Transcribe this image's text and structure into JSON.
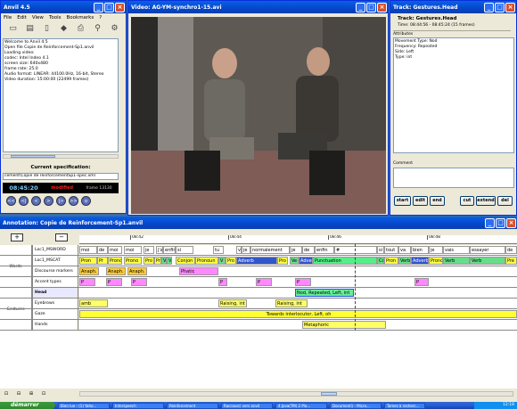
{
  "anvil_window": {
    "title": "Anvil 4.5",
    "menu": [
      "File",
      "Edit",
      "View",
      "Tools",
      "Bookmarks",
      "?"
    ],
    "toolbar_icons": [
      "open-file-icon",
      "save-icon",
      "document-icon",
      "diamond-icon",
      "print-icon",
      "find-icon",
      "settings-icon"
    ],
    "log_lines": [
      "Welcome to Anvil 4.5",
      "Open file Copie de Reinforcement-Sp1.anvil",
      "Loading video:",
      "    codec: Intel Indeo 4.1",
      "    screen size: 640x480",
      "    frame rate: 25.0",
      "Audio format: LINEAR: 44100.0Hz, 16-bit, Stereo",
      "Video duration: 15:00:00 (22499 frames)"
    ],
    "spec_heading": "Current specification:",
    "spec_file": "cement\\Copie de reinforcementSp1-spec.xml",
    "timecode": "08:45:20",
    "modified": "modified",
    "frame": "frame 13130",
    "playback_buttons": [
      "<<",
      "<|",
      "<",
      ">",
      "|>",
      ">>",
      "o"
    ]
  },
  "video_window": {
    "title": "Video: AG-YM-synchro1-15.avi"
  },
  "track_window": {
    "title": "Track: Gestures.Head",
    "track_name": "Track: Gestures.Head",
    "time": "Time: 08:44:56 - 08:45:24 (15 frames)",
    "attributes_label": "Attributes",
    "attributes": [
      "Movement Type: Nod",
      "Frequency: Repeated",
      "Side: Left",
      "Type: int"
    ],
    "comment_label": "Comment",
    "buttons": [
      "start",
      "edit",
      "end",
      "cut",
      "extend",
      "del"
    ]
  },
  "annotation_window": {
    "title": "Annotation: Copie de Reinforcement-Sp1.anvil",
    "ruler_ticks": [
      "08:42",
      "08:44",
      "08:46",
      "08:48"
    ],
    "groups": [
      {
        "name": "Words",
        "tiers": [
          {
            "label": "Loc1_MSWORD",
            "segments": [
              "moi",
              "de",
              "moi",
              "moi",
              "je",
              "j'a",
              "enfin",
              "si",
              "tu",
              "v",
              "je",
              "normalement",
              "je",
              "de",
              "enfin",
              "#",
              "si",
              "tout",
              "va",
              "bien",
              "je",
              "vais",
              "essayer",
              "de"
            ]
          },
          {
            "label": "Loc1_MSCAT",
            "segments": [
              "Pron",
              "Pr",
              "Prono",
              "Prono",
              "Pro",
              "Pro",
              "V",
              "V",
              "Conjon",
              "Pronoun",
              "V",
              "Pro",
              "Adverb",
              "Pro",
              "Ve",
              "Adverb",
              "Punctuation",
              "Co",
              "Pron",
              "Verb",
              "Adverb",
              "Prono",
              "Verb",
              "Verb",
              "Pre"
            ]
          },
          {
            "label": "Discourse markers",
            "segments": [
              "Anaph.",
              "Anaph.",
              "Anaph.",
              "Phatic"
            ]
          },
          {
            "label": "Accent types",
            "segments": [
              "P",
              "P",
              "P",
              "P",
              "P",
              "P",
              "P"
            ]
          }
        ]
      },
      {
        "name": "Gestures",
        "tiers": [
          {
            "label": "Head",
            "segments": [
              "Nod, Repeated, Left, int"
            ]
          },
          {
            "label": "Eyebrows",
            "segments": [
              "amb",
              "Raising, int",
              "Raising, int"
            ]
          },
          {
            "label": "Gaze",
            "segments": [
              "Towards interlocutor, Left, oh"
            ]
          },
          {
            "label": "Hands",
            "segments": [
              "Metaphoric"
            ]
          }
        ]
      }
    ]
  },
  "taskbar": {
    "start": "démarrer",
    "tasks": [
      "Bien lue - (1) Yaho...",
      "Interspeech",
      "Reinforcement",
      "Raccourci vers anvil",
      "4 Java(TM) 2 Pla...",
      "Document1 - Micro...",
      "Tomes à recherc..."
    ],
    "clock": "12:18"
  },
  "colors": {
    "accent": "#0a5fe8",
    "yellow": "#ffff66",
    "green": "#66dd88",
    "blue": "#3355cc",
    "pink": "#ff88ff",
    "orange": "#ffcc33"
  }
}
